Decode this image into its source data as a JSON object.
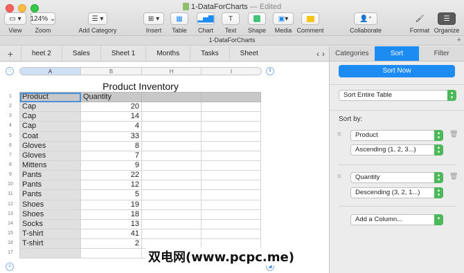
{
  "window": {
    "title": "1-DataForCharts",
    "status": "— Edited",
    "tab_title": "1-DataForCharts"
  },
  "toolbar": {
    "view": "View",
    "zoom": "Zoom",
    "zoom_value": "124%",
    "add_category": "Add Category",
    "insert": "Insert",
    "table": "Table",
    "chart": "Chart",
    "text": "Text",
    "shape": "Shape",
    "media": "Media",
    "comment": "Comment",
    "collaborate": "Collaborate",
    "format": "Format",
    "organize": "Organize"
  },
  "sheets": [
    "heet 2",
    "Sales",
    "Sheet 1",
    "Months",
    "Tasks",
    "Sheet"
  ],
  "columns": [
    "A",
    "B",
    "H",
    "I"
  ],
  "table": {
    "title": "Product Inventory",
    "headers": [
      "Product",
      "Quantity"
    ],
    "rows": [
      [
        "Cap",
        "20"
      ],
      [
        "Cap",
        "14"
      ],
      [
        "Cap",
        "4"
      ],
      [
        "Coat",
        "33"
      ],
      [
        "Gloves",
        "8"
      ],
      [
        "Gloves",
        "7"
      ],
      [
        "Mittens",
        "9"
      ],
      [
        "Pants",
        "22"
      ],
      [
        "Pants",
        "12"
      ],
      [
        "Pants",
        "5"
      ],
      [
        "Shoes",
        "19"
      ],
      [
        "Shoes",
        "18"
      ],
      [
        "Socks",
        "13"
      ],
      [
        "T-shirt",
        "41"
      ],
      [
        "T-shirt",
        "2"
      ],
      [
        "",
        ""
      ]
    ],
    "row_numbers": [
      "1",
      "2",
      "3",
      "4",
      "5",
      "6",
      "7",
      "8",
      "9",
      "10",
      "11",
      "12",
      "13",
      "14",
      "15",
      "16",
      "17"
    ]
  },
  "sidebar": {
    "tabs": [
      "Categories",
      "Sort",
      "Filter"
    ],
    "active_tab": "Sort",
    "sort_now": "Sort Now",
    "scope": "Sort Entire Table",
    "sort_by_label": "Sort by:",
    "rule1_column": "Product",
    "rule1_order": "Ascending (1, 2, 3...)",
    "rule2_column": "Quantity",
    "rule2_order": "Descending (3, 2, 1...)",
    "add_column": "Add a Column..."
  },
  "watermark": "双电网(www.pcpc.me)",
  "colors": {
    "accent": "#1c8cf3",
    "popup_arrow": "#4cb85a"
  }
}
